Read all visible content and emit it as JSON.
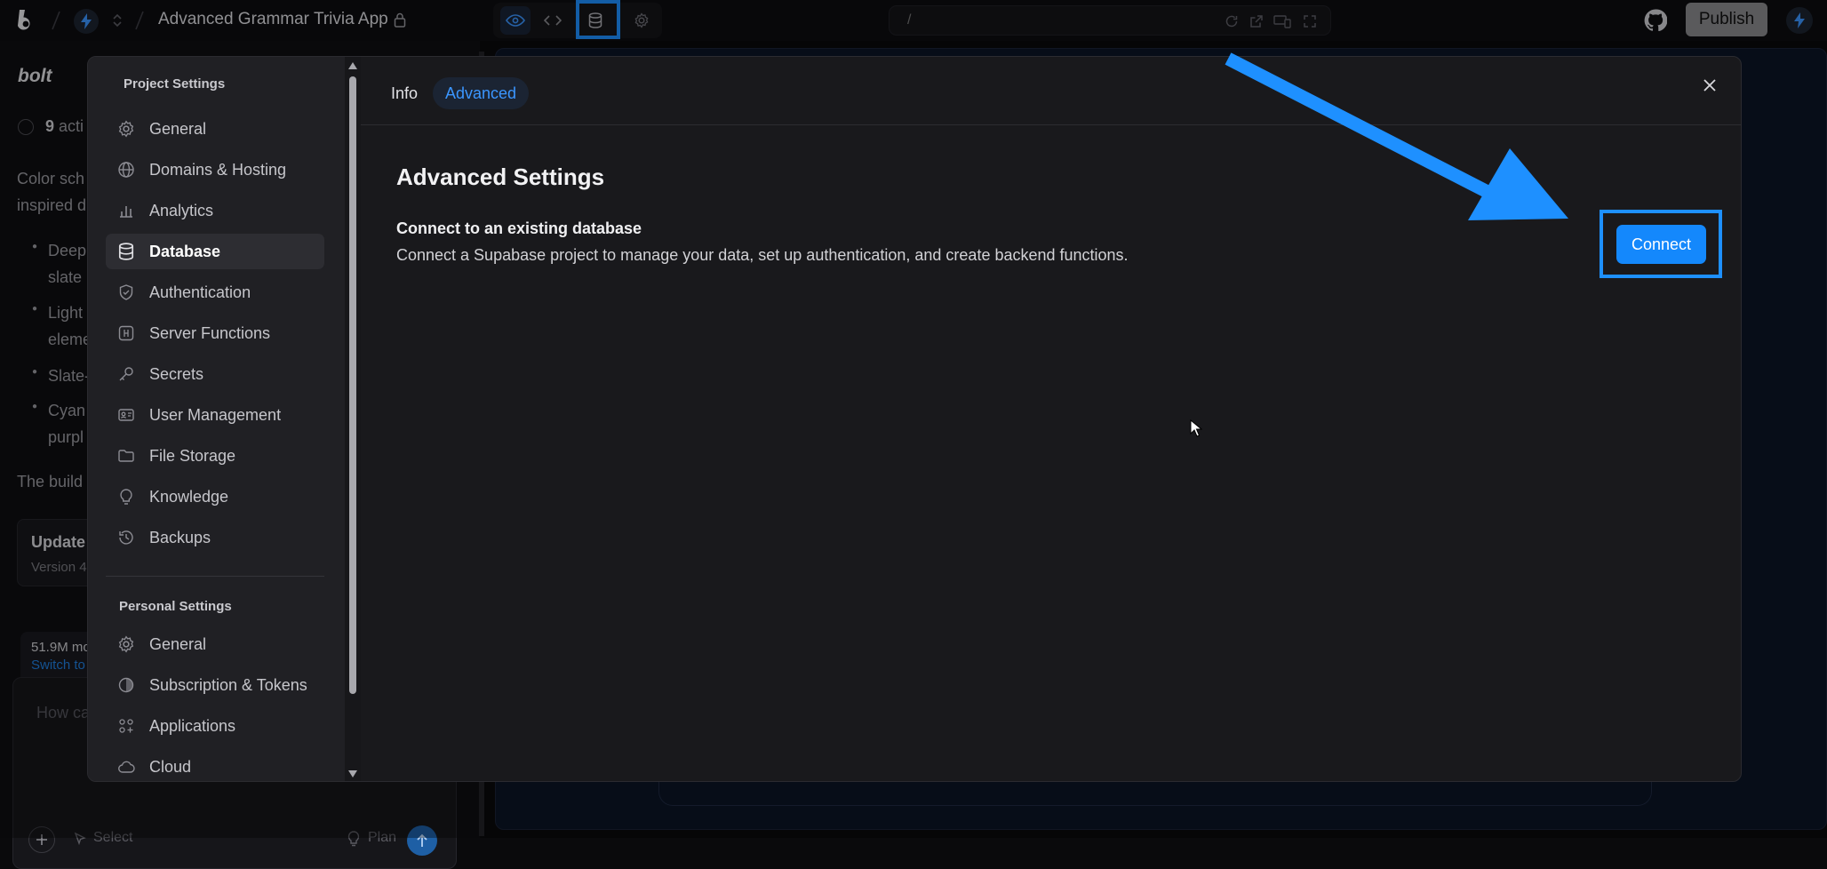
{
  "topbar": {
    "project_title": "Advanced Grammar Trivia App",
    "url": "/",
    "publish_label": "Publish"
  },
  "chat": {
    "brand": "bolt",
    "actions_count": "9",
    "actions_text": "acti",
    "line1": "Color sch",
    "line2": "inspired d",
    "bullets": [
      "Deep",
      "slate",
      "Light",
      "eleme",
      "Slate-",
      "Cyan",
      "purpl"
    ],
    "build_text": "The build",
    "update_title": "Update",
    "version_text": "Version 4",
    "usage_text": "51.9M mo",
    "switch_text": "Switch to",
    "input_placeholder": "How ca",
    "select_label": "Select",
    "plan_label": "Plan"
  },
  "modal": {
    "project_settings_title": "Project Settings",
    "project_items": [
      {
        "label": "General",
        "icon": "gear-icon"
      },
      {
        "label": "Domains & Hosting",
        "icon": "globe-icon"
      },
      {
        "label": "Analytics",
        "icon": "bar-chart-icon"
      },
      {
        "label": "Database",
        "icon": "database-icon",
        "active": true
      },
      {
        "label": "Authentication",
        "icon": "shield-icon"
      },
      {
        "label": "Server Functions",
        "icon": "function-icon"
      },
      {
        "label": "Secrets",
        "icon": "key-icon"
      },
      {
        "label": "User Management",
        "icon": "id-card-icon"
      },
      {
        "label": "File Storage",
        "icon": "folder-icon"
      },
      {
        "label": "Knowledge",
        "icon": "lightbulb-icon"
      },
      {
        "label": "Backups",
        "icon": "history-icon"
      }
    ],
    "personal_settings_title": "Personal Settings",
    "personal_items": [
      {
        "label": "General",
        "icon": "gear-icon"
      },
      {
        "label": "Subscription & Tokens",
        "icon": "coin-icon"
      },
      {
        "label": "Applications",
        "icon": "apps-icon"
      },
      {
        "label": "Cloud",
        "icon": "cloud-icon"
      }
    ],
    "tabs": [
      "Info",
      "Advanced"
    ],
    "active_tab": "Advanced",
    "heading": "Advanced Settings",
    "connect_title": "Connect to an existing database",
    "connect_desc": "Connect a Supabase project to manage your data, set up authentication, and create backend functions.",
    "connect_button": "Connect"
  },
  "colors": {
    "accent": "#1488fc",
    "highlight": "#1e90ff",
    "modal_bg": "#19191c",
    "sidebar_bg": "#202024"
  }
}
